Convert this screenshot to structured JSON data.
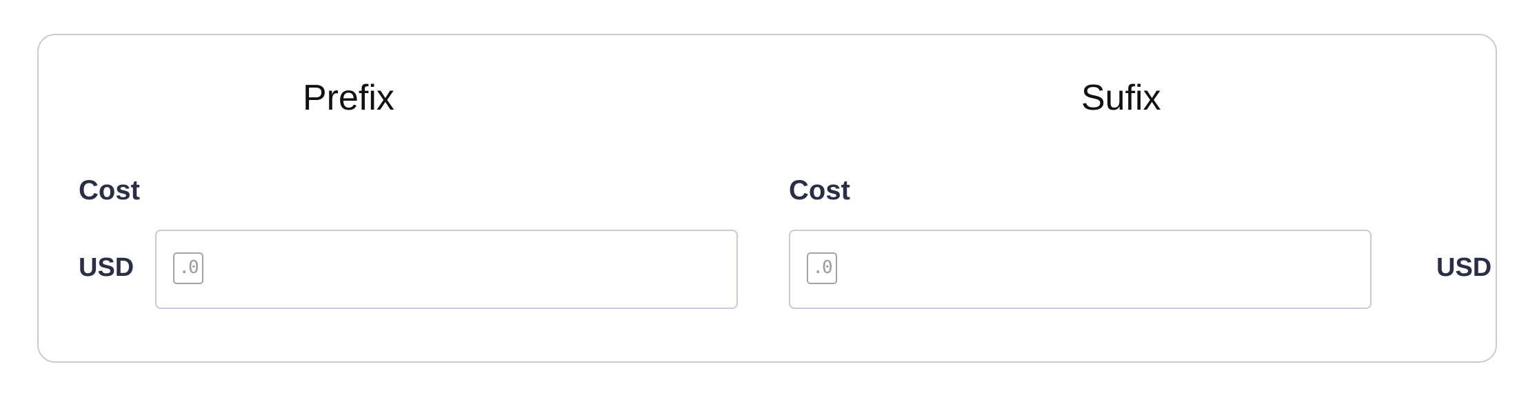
{
  "prefix_section": {
    "title": "Prefix",
    "field_label": "Cost",
    "affix": "USD",
    "input_value": "",
    "decimal_badge": ".0"
  },
  "suffix_section": {
    "title": "Sufix",
    "field_label": "Cost",
    "affix": "USD",
    "input_value": "",
    "decimal_badge": ".0"
  },
  "colors": {
    "card_border": "#c9cbd3",
    "label_text": "#2a2f45",
    "input_border": "#c9c9d9",
    "badge": "#a2a3aa"
  },
  "icons": {
    "decimal_badge": "decimal-places-icon"
  }
}
